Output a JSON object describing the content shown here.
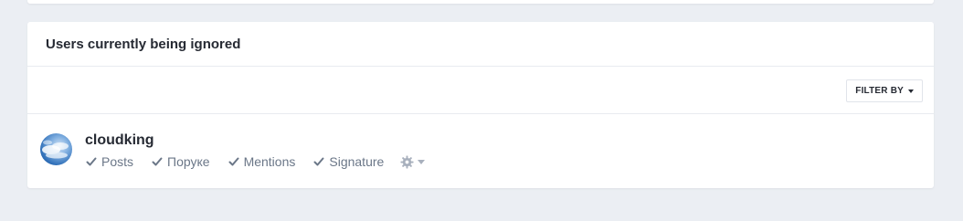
{
  "panel": {
    "title": "Users currently being ignored"
  },
  "filter": {
    "label": "FILTER BY"
  },
  "users": [
    {
      "name": "cloudking",
      "ignored": [
        {
          "label": "Posts",
          "icon": "check-icon"
        },
        {
          "label": "Поруке",
          "icon": "check-icon"
        },
        {
          "label": "Mentions",
          "icon": "check-icon"
        },
        {
          "label": "Signature",
          "icon": "check-icon"
        }
      ],
      "options_icon": "gear-icon"
    }
  ],
  "colors": {
    "background": "#ebeef3",
    "panel": "#ffffff",
    "text_dark": "#262a33",
    "text_muted": "#6b7788"
  }
}
